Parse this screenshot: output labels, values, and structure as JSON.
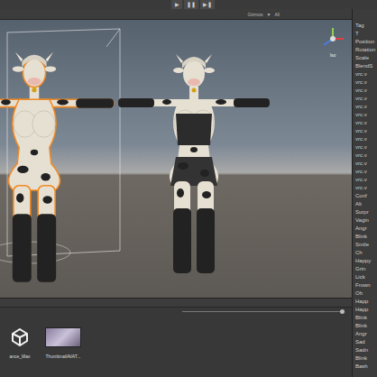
{
  "toolbar": {
    "buttons": [
      "▶",
      "❚❚",
      "▶❚"
    ]
  },
  "scene": {
    "tabs": [
      "Gizmos",
      "▼",
      "All"
    ],
    "gizmo_label": "Iso",
    "objects": [
      {
        "selected": true
      },
      {
        "selected": false
      }
    ]
  },
  "inspector": {
    "rows": [
      "Tag",
      "T",
      "Position",
      "Rotation",
      "Scale",
      "BlendS",
      "vrc.v",
      "vrc.v",
      "vrc.v",
      "vrc.v",
      "vrc.v",
      "vrc.v",
      "vrc.v",
      "vrc.v",
      "vrc.v",
      "vrc.v",
      "vrc.v",
      "vrc.v",
      "vrc.v",
      "vrc.v",
      "vrc.v",
      "Conf",
      "Alt",
      "Surpr",
      "Vagin",
      "Angr",
      "Blink",
      "Smile",
      "Ch",
      "Happy",
      "Grin",
      "Lick",
      "Frown",
      "Oh",
      "Happ",
      "Happ",
      "Blink",
      "Blink",
      "Angr",
      "Sad",
      "Sadn",
      "Blink",
      "Bash"
    ]
  },
  "project": {
    "assets": [
      {
        "label": "ance_Max",
        "kind": "unity"
      },
      {
        "label": "ThumbnailAVAT...",
        "kind": "thumbnail"
      }
    ]
  }
}
